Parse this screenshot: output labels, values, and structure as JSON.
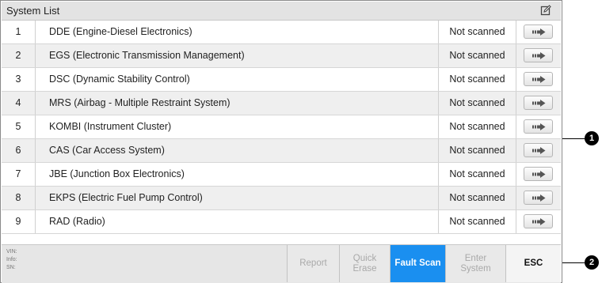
{
  "header": {
    "title": "System List",
    "edit_icon": "edit-icon"
  },
  "systems": [
    {
      "num": "1",
      "name": "DDE (Engine-Diesel Electronics)",
      "status": "Not scanned"
    },
    {
      "num": "2",
      "name": "EGS (Electronic Transmission Management)",
      "status": "Not scanned"
    },
    {
      "num": "3",
      "name": "DSC (Dynamic Stability Control)",
      "status": "Not scanned"
    },
    {
      "num": "4",
      "name": "MRS (Airbag - Multiple Restraint System)",
      "status": "Not scanned"
    },
    {
      "num": "5",
      "name": "KOMBI (Instrument Cluster)",
      "status": "Not scanned"
    },
    {
      "num": "6",
      "name": "CAS (Car Access System)",
      "status": "Not scanned"
    },
    {
      "num": "7",
      "name": "JBE (Junction Box Electronics)",
      "status": "Not scanned"
    },
    {
      "num": "8",
      "name": "EKPS (Electric Fuel Pump Control)",
      "status": "Not scanned"
    },
    {
      "num": "9",
      "name": "RAD (Radio)",
      "status": "Not scanned"
    }
  ],
  "footer": {
    "vin_label": "VIN:",
    "info_label": "Info:",
    "sn_label": "SN:",
    "buttons": {
      "report": "Report",
      "quick_erase_1": "Quick",
      "quick_erase_2": "Erase",
      "fault_scan": "Fault Scan",
      "enter_system_1": "Enter",
      "enter_system_2": "System",
      "esc": "ESC"
    }
  },
  "callouts": {
    "one": "1",
    "two": "2"
  },
  "colors": {
    "primary": "#1a8ff0",
    "header_bg": "#e3e3e3",
    "row_alt": "#efefef"
  }
}
